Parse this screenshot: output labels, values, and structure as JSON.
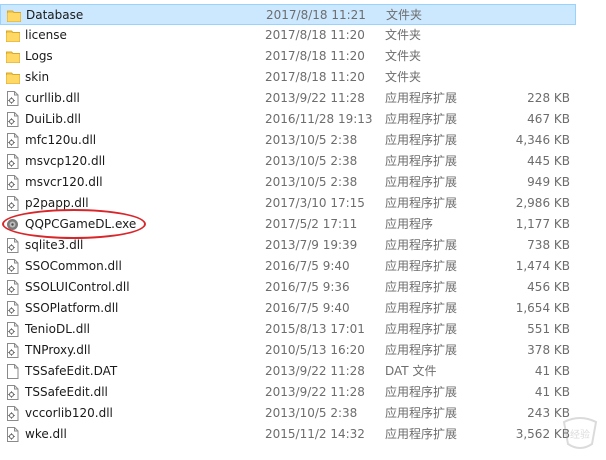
{
  "files": [
    {
      "name": "Database",
      "date": "2017/8/18 11:21",
      "type": "文件夹",
      "size": "",
      "icon": "folder-icon"
    },
    {
      "name": "license",
      "date": "2017/8/18 11:20",
      "type": "文件夹",
      "size": "",
      "icon": "folder-icon"
    },
    {
      "name": "Logs",
      "date": "2017/8/18 11:20",
      "type": "文件夹",
      "size": "",
      "icon": "folder-icon"
    },
    {
      "name": "skin",
      "date": "2017/8/18 11:20",
      "type": "文件夹",
      "size": "",
      "icon": "folder-icon"
    },
    {
      "name": "curllib.dll",
      "date": "2013/9/22 11:28",
      "type": "应用程序扩展",
      "size": "228 KB",
      "icon": "dll-file-icon"
    },
    {
      "name": "DuiLib.dll",
      "date": "2016/11/28 19:13",
      "type": "应用程序扩展",
      "size": "467 KB",
      "icon": "dll-file-icon"
    },
    {
      "name": "mfc120u.dll",
      "date": "2013/10/5 2:38",
      "type": "应用程序扩展",
      "size": "4,346 KB",
      "icon": "dll-file-icon"
    },
    {
      "name": "msvcp120.dll",
      "date": "2013/10/5 2:38",
      "type": "应用程序扩展",
      "size": "445 KB",
      "icon": "dll-file-icon"
    },
    {
      "name": "msvcr120.dll",
      "date": "2013/10/5 2:38",
      "type": "应用程序扩展",
      "size": "949 KB",
      "icon": "dll-file-icon"
    },
    {
      "name": "p2papp.dll",
      "date": "2017/3/10 17:15",
      "type": "应用程序扩展",
      "size": "2,986 KB",
      "icon": "dll-file-icon"
    },
    {
      "name": "QQPCGameDL.exe",
      "date": "2017/5/2 17:11",
      "type": "应用程序",
      "size": "1,177 KB",
      "icon": "exe-file-icon"
    },
    {
      "name": "sqlite3.dll",
      "date": "2013/7/9 19:39",
      "type": "应用程序扩展",
      "size": "738 KB",
      "icon": "dll-file-icon"
    },
    {
      "name": "SSOCommon.dll",
      "date": "2016/7/5 9:40",
      "type": "应用程序扩展",
      "size": "1,474 KB",
      "icon": "dll-file-icon"
    },
    {
      "name": "SSOLUIControl.dll",
      "date": "2016/7/5 9:36",
      "type": "应用程序扩展",
      "size": "456 KB",
      "icon": "dll-file-icon"
    },
    {
      "name": "SSOPlatform.dll",
      "date": "2016/7/5 9:40",
      "type": "应用程序扩展",
      "size": "1,654 KB",
      "icon": "dll-file-icon"
    },
    {
      "name": "TenioDL.dll",
      "date": "2015/8/13 17:01",
      "type": "应用程序扩展",
      "size": "551 KB",
      "icon": "dll-file-icon"
    },
    {
      "name": "TNProxy.dll",
      "date": "2010/5/13 16:20",
      "type": "应用程序扩展",
      "size": "378 KB",
      "icon": "dll-file-icon"
    },
    {
      "name": "TSSafeEdit.DAT",
      "date": "2013/9/22 11:28",
      "type": "DAT 文件",
      "size": "41 KB",
      "icon": "dat-file-icon"
    },
    {
      "name": "TSSafeEdit.dll",
      "date": "2013/9/22 11:28",
      "type": "应用程序扩展",
      "size": "41 KB",
      "icon": "dll-file-icon"
    },
    {
      "name": "vccorlib120.dll",
      "date": "2013/10/5 2:38",
      "type": "应用程序扩展",
      "size": "243 KB",
      "icon": "dll-file-icon"
    },
    {
      "name": "wke.dll",
      "date": "2015/11/2 14:32",
      "type": "应用程序扩展",
      "size": "3,562 KB",
      "icon": "dll-file-icon"
    }
  ],
  "selected_index": 0,
  "annotation": {
    "shape": "ellipse",
    "color": "#d9262a",
    "target": "QQPCGameDL.exe"
  },
  "colors": {
    "folder": "#f4c84a",
    "selection_bg": "#cce8ff",
    "selection_border": "#99d1ff",
    "secondary_text": "#6d6d6d"
  }
}
